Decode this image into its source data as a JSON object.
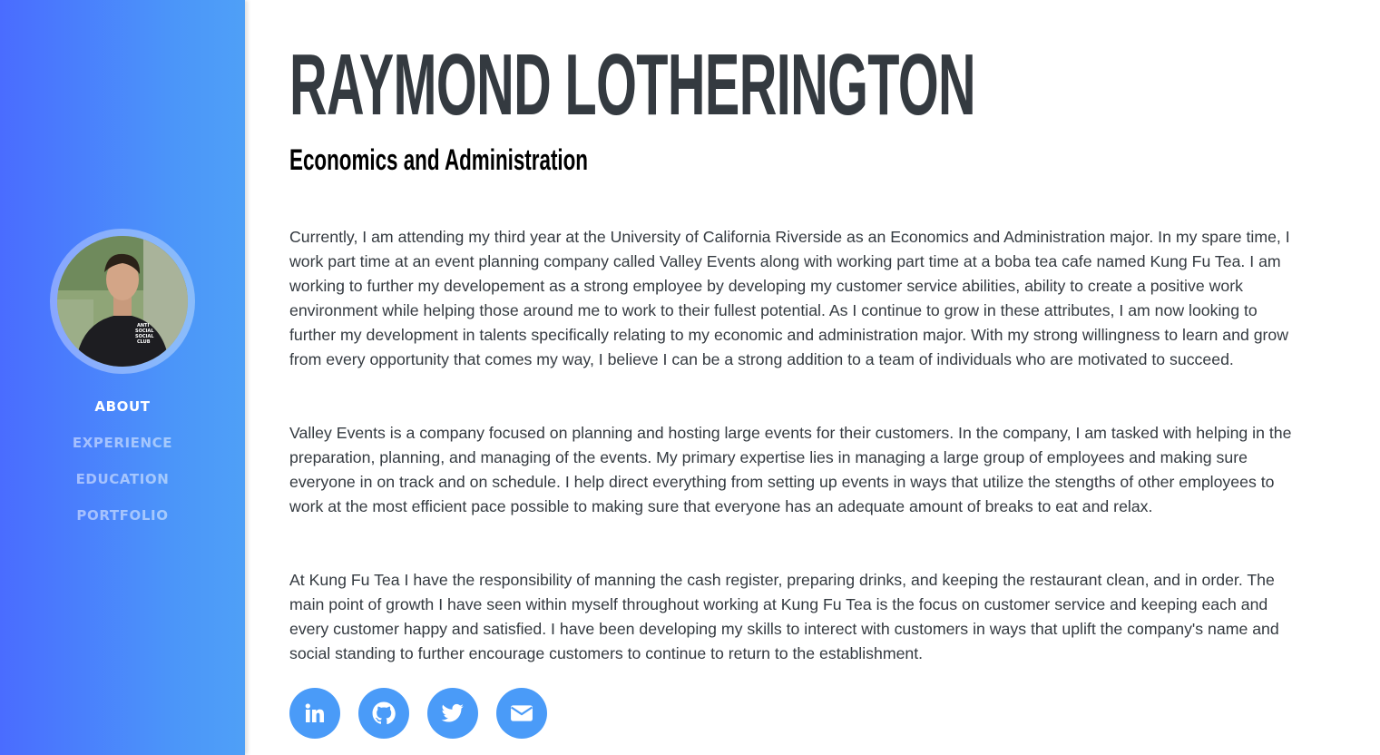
{
  "sidebar": {
    "nav": [
      {
        "label": "About",
        "active": true
      },
      {
        "label": "Experience",
        "active": false
      },
      {
        "label": "Education",
        "active": false
      },
      {
        "label": "Portfolio",
        "active": false
      }
    ],
    "avatar_hoodie_text": [
      "ANTI",
      "SOCIAL",
      "SOCIAL",
      "CLUB"
    ]
  },
  "main": {
    "name": "RAYMOND LOTHERINGTON",
    "subtitle": "Economics and Administration",
    "paragraphs": [
      "Currently, I am attending my third year at the University of California Riverside as an Economics and Administration major. In my spare time, I work part time at an event planning company called Valley Events along with working part time at a boba tea cafe named Kung Fu Tea. I am working to further my developement as a strong employee by developing my customer service abilities, ability to create a positive work environment while helping those around me to work to their fullest potential. As I continue to grow in these attributes, I am now looking to further my development in talents specifically relating to my economic and administration major. With my strong willingness to learn and grow from every opportunity that comes my way, I believe I can be a strong addition to a team of individuals who are motivated to succeed.",
      "Valley Events is a company focused on planning and hosting large events for their customers. In the company, I am tasked with helping in the preparation, planning, and managing of the events. My primary expertise lies in managing a large group of employees and making sure everyone in on track and on schedule. I help direct everything from setting up events in ways that utilize the stengths of other employees to work at the most efficient pace possible to making sure that everyone has an adequate amount of breaks to eat and relax.",
      "At Kung Fu Tea I have the responsibility of manning the cash register, preparing drinks, and keeping the restaurant clean, and in order. The main point of growth I have seen within myself throughout working at Kung Fu Tea is the focus on customer service and keeping each and every customer happy and satisfied. I have been developing my skills to interect with customers in ways that uplift the company's name and social standing to further encourage customers to continue to return to the establishment."
    ],
    "socials": [
      {
        "icon": "linkedin-icon"
      },
      {
        "icon": "github-icon"
      },
      {
        "icon": "twitter-icon"
      },
      {
        "icon": "envelope-icon"
      }
    ]
  },
  "colors": {
    "sidebar_gradient_start": "#4a6cff",
    "sidebar_gradient_end": "#4fa0f7",
    "social_button": "#4a9bf8",
    "heading": "#343a40"
  }
}
